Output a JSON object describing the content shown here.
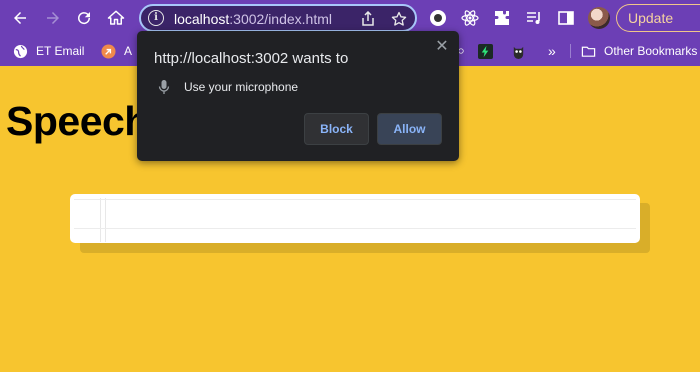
{
  "browser": {
    "url_host": "localhost",
    "url_rest": ":3002/index.html",
    "update_label": "Update",
    "icons": [
      "back-arrow-icon",
      "forward-arrow-icon",
      "reload-icon",
      "home-icon",
      "site-info-icon",
      "share-icon",
      "bookmark-star-icon",
      "extension-icon-1",
      "react-devtools-icon",
      "puzzle-extensions-icon",
      "media-control-icon",
      "side-panel-icon"
    ]
  },
  "bookmarks": {
    "items": [
      {
        "label": "ET Email",
        "icon": "globe-icon"
      },
      {
        "label": "A",
        "icon": "arrow-badge-icon"
      },
      {
        "label": "",
        "icon": "partial-icon"
      },
      {
        "label": "",
        "icon": "bolt-bookmark-icon"
      },
      {
        "label": "",
        "icon": "owl-bookmark-icon"
      }
    ],
    "overflow_label": "»",
    "other_label": "Other Bookmarks"
  },
  "page": {
    "title": "Speech"
  },
  "permission_popup": {
    "title": "http://localhost:3002 wants to",
    "close_glyph": "✕",
    "permission": "Use your microphone",
    "block_label": "Block",
    "allow_label": "Allow"
  },
  "colors": {
    "page_background": "#f7c52f",
    "toolbar": "#6c3fb5",
    "popup_background": "#202124",
    "popup_button_text": "#8ab4f8"
  }
}
